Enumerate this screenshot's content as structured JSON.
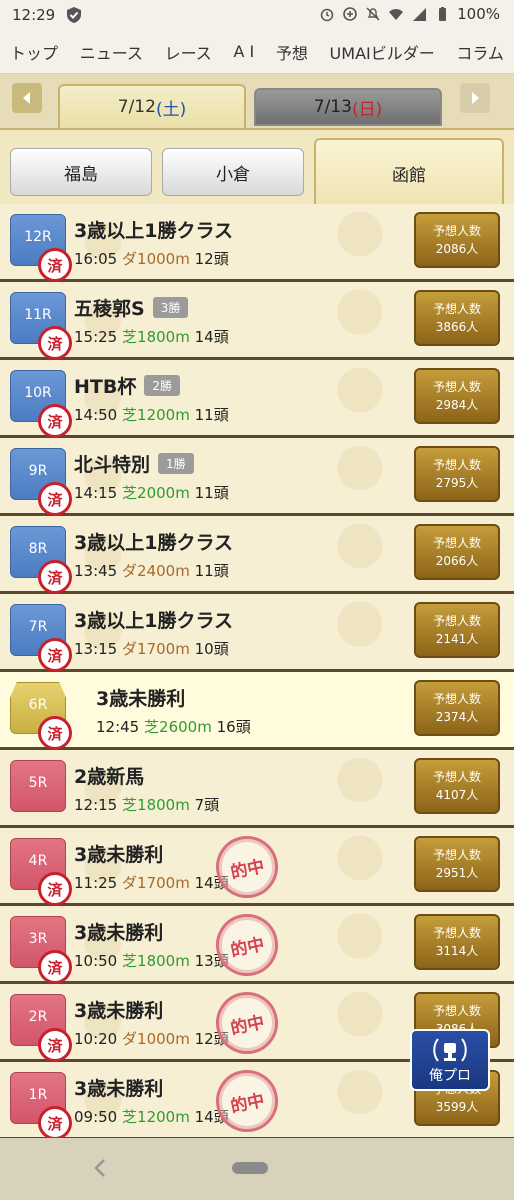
{
  "status": {
    "time": "12:29",
    "battery": "100%"
  },
  "nav": [
    "トップ",
    "ニュース",
    "レース",
    "A I",
    "予想",
    "UMAIビルダー",
    "コラム"
  ],
  "dates": {
    "active": {
      "md": "7/12",
      "dow": "(土)"
    },
    "inactive": {
      "md": "7/13",
      "dow": "(日)"
    }
  },
  "venues": [
    "福島",
    "小倉",
    "函館"
  ],
  "races": [
    {
      "no": "12R",
      "name": "3歳以上1勝クラス",
      "grade": "",
      "time": "16:05",
      "surface": "ダ",
      "dist": "1000m",
      "heads": "12頭",
      "yoso_label": "予想人数",
      "yoso_count": "2086人",
      "done": true,
      "hit": false,
      "color": "blue"
    },
    {
      "no": "11R",
      "name": "五稜郭S",
      "grade": "3勝",
      "time": "15:25",
      "surface": "芝",
      "dist": "1800m",
      "heads": "14頭",
      "yoso_label": "予想人数",
      "yoso_count": "3866人",
      "done": true,
      "hit": false,
      "color": "blue"
    },
    {
      "no": "10R",
      "name": "HTB杯",
      "grade": "2勝",
      "time": "14:50",
      "surface": "芝",
      "dist": "1200m",
      "heads": "11頭",
      "yoso_label": "予想人数",
      "yoso_count": "2984人",
      "done": true,
      "hit": false,
      "color": "blue"
    },
    {
      "no": "9R",
      "name": "北斗特別",
      "grade": "1勝",
      "time": "14:15",
      "surface": "芝",
      "dist": "2000m",
      "heads": "11頭",
      "yoso_label": "予想人数",
      "yoso_count": "2795人",
      "done": true,
      "hit": false,
      "color": "blue"
    },
    {
      "no": "8R",
      "name": "3歳以上1勝クラス",
      "grade": "",
      "time": "13:45",
      "surface": "ダ",
      "dist": "2400m",
      "heads": "11頭",
      "yoso_label": "予想人数",
      "yoso_count": "2066人",
      "done": true,
      "hit": false,
      "color": "blue"
    },
    {
      "no": "7R",
      "name": "3歳以上1勝クラス",
      "grade": "",
      "time": "13:15",
      "surface": "ダ",
      "dist": "1700m",
      "heads": "10頭",
      "yoso_label": "予想人数",
      "yoso_count": "2141人",
      "done": true,
      "hit": false,
      "color": "blue"
    },
    {
      "no": "6R",
      "name": "3歳未勝利",
      "grade": "",
      "time": "12:45",
      "surface": "芝",
      "dist": "2600m",
      "heads": "16頭",
      "yoso_label": "予想人数",
      "yoso_count": "2374人",
      "done": true,
      "hit": false,
      "color": "gold"
    },
    {
      "no": "5R",
      "name": "2歳新馬",
      "grade": "",
      "time": "12:15",
      "surface": "芝",
      "dist": "1800m",
      "heads": "7頭",
      "yoso_label": "予想人数",
      "yoso_count": "4107人",
      "done": false,
      "hit": false,
      "color": "red"
    },
    {
      "no": "4R",
      "name": "3歳未勝利",
      "grade": "",
      "time": "11:25",
      "surface": "ダ",
      "dist": "1700m",
      "heads": "14頭",
      "yoso_label": "予想人数",
      "yoso_count": "2951人",
      "done": true,
      "hit": true,
      "color": "red"
    },
    {
      "no": "3R",
      "name": "3歳未勝利",
      "grade": "",
      "time": "10:50",
      "surface": "芝",
      "dist": "1800m",
      "heads": "13頭",
      "yoso_label": "予想人数",
      "yoso_count": "3114人",
      "done": true,
      "hit": true,
      "color": "red"
    },
    {
      "no": "2R",
      "name": "3歳未勝利",
      "grade": "",
      "time": "10:20",
      "surface": "ダ",
      "dist": "1000m",
      "heads": "12頭",
      "yoso_label": "予想人数",
      "yoso_count": "3086人",
      "done": true,
      "hit": true,
      "color": "red"
    },
    {
      "no": "1R",
      "name": "3歳未勝利",
      "grade": "",
      "time": "09:50",
      "surface": "芝",
      "dist": "1200m",
      "heads": "14頭",
      "yoso_label": "予想人数",
      "yoso_count": "3599人",
      "done": true,
      "hit": true,
      "color": "red"
    }
  ],
  "stamps": {
    "done": "済",
    "hit": "的中"
  },
  "floating": {
    "label": "俺プロ"
  },
  "icons": [
    "shield-icon",
    "alarm-icon",
    "data-saver-icon",
    "mute-icon",
    "wifi-icon",
    "signal-icon",
    "battery-icon",
    "arrow-left-icon",
    "arrow-right-icon",
    "laurel-icon",
    "back-icon"
  ]
}
